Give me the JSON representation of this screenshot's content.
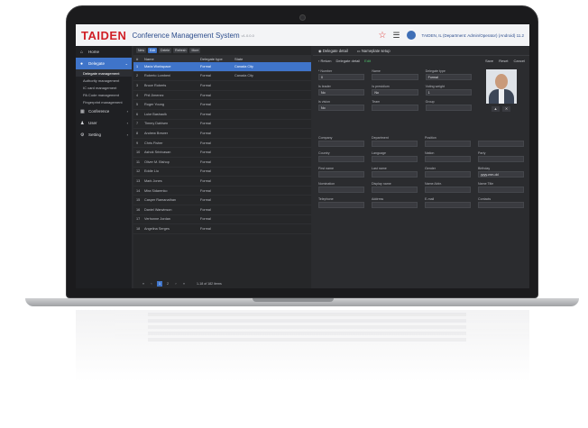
{
  "header": {
    "logo": "TAIDEN",
    "title": "Conference Management System",
    "version": "v1.0.0.0",
    "user": "TAIDEN, IL (Department: Admin/Operator) (Android) 11.2"
  },
  "sidebar": {
    "items": [
      {
        "label": "Home",
        "icon": "home-icon"
      },
      {
        "label": "Delegate",
        "icon": "person-icon",
        "active": true
      },
      {
        "label": "Conference",
        "icon": "grid-icon"
      },
      {
        "label": "User",
        "icon": "user-icon"
      },
      {
        "label": "Setting",
        "icon": "gear-icon"
      }
    ],
    "subitems": [
      "Delegate management",
      "Authority management",
      "IC card management",
      "PA Code management",
      "Fingerprint management"
    ]
  },
  "list": {
    "toolbar": [
      "New",
      "Edit",
      "Delete",
      "Refresh",
      "More"
    ],
    "columns": [
      "#",
      "Name",
      "Delegate type",
      "State"
    ],
    "rows": [
      {
        "n": "1",
        "name": "Maria Workspace",
        "type": "Formal",
        "state": "Canada City"
      },
      {
        "n": "2",
        "name": "Roberto Lombeni",
        "type": "Formal",
        "state": "Canada City"
      },
      {
        "n": "3",
        "name": "Bruce Roberts",
        "type": "Formal",
        "state": ""
      },
      {
        "n": "4",
        "name": "Phil Jimenez",
        "type": "Formal",
        "state": ""
      },
      {
        "n": "5",
        "name": "Roger Young",
        "type": "Formal",
        "state": ""
      },
      {
        "n": "6",
        "name": "Luke Bashaolk",
        "type": "Formal",
        "state": ""
      },
      {
        "n": "7",
        "name": "Timmy Dahlsen",
        "type": "Formal",
        "state": ""
      },
      {
        "n": "8",
        "name": "Andrew Brewer",
        "type": "Formal",
        "state": ""
      },
      {
        "n": "9",
        "name": "Chris Fisher",
        "type": "Formal",
        "state": ""
      },
      {
        "n": "10",
        "name": "Ashok Srinivasan",
        "type": "Formal",
        "state": ""
      },
      {
        "n": "11",
        "name": "Oliver M. Bishop",
        "type": "Formal",
        "state": ""
      },
      {
        "n": "12",
        "name": "Eddie Liu",
        "type": "Formal",
        "state": ""
      },
      {
        "n": "13",
        "name": "Mark Jones",
        "type": "Formal",
        "state": ""
      },
      {
        "n": "14",
        "name": "Mira Sidarenko",
        "type": "Formal",
        "state": ""
      },
      {
        "n": "15",
        "name": "Casper Ramanathan",
        "type": "Formal",
        "state": ""
      },
      {
        "n": "16",
        "name": "Daniel Warwinson",
        "type": "Formal",
        "state": ""
      },
      {
        "n": "17",
        "name": "Verhonne Jordan",
        "type": "Formal",
        "state": ""
      },
      {
        "n": "18",
        "name": "Angelina Serges",
        "type": "Formal",
        "state": ""
      }
    ],
    "pager": {
      "pages": [
        "1",
        "2"
      ],
      "current": "1",
      "summary": "1-18 of 182 items"
    }
  },
  "detail": {
    "tabs": [
      "Delegate detail",
      "Nameplate setup"
    ],
    "subbar": {
      "back": "Return",
      "crumb": "Delegate detail",
      "status": "Edit",
      "actions": [
        "Save",
        "Reset",
        "Cancel"
      ]
    },
    "fields_top": [
      [
        {
          "label": "* Number",
          "value": "0"
        },
        {
          "label": "Name",
          "value": ""
        },
        {
          "label": "Delegate type",
          "value": "Formal"
        }
      ],
      [
        {
          "label": "Is leader",
          "value": "No"
        },
        {
          "label": "Is presidium",
          "value": "No"
        },
        {
          "label": "Voting weight",
          "value": "1"
        }
      ],
      [
        {
          "label": "Is vision",
          "value": "No"
        },
        {
          "label": "Team",
          "value": ""
        },
        {
          "label": "Group",
          "value": ""
        }
      ]
    ],
    "fields_grid": [
      [
        {
          "label": "Company",
          "value": ""
        },
        {
          "label": "Department",
          "value": ""
        },
        {
          "label": "Position",
          "value": ""
        },
        {
          "label": "",
          "value": ""
        }
      ],
      [
        {
          "label": "Country",
          "value": ""
        },
        {
          "label": "Language",
          "value": ""
        },
        {
          "label": "Nation",
          "value": ""
        },
        {
          "label": "Party",
          "value": ""
        }
      ],
      [
        {
          "label": "First name",
          "value": ""
        },
        {
          "label": "Last name",
          "value": ""
        },
        {
          "label": "Gender",
          "value": ""
        },
        {
          "label": "Birthday",
          "value": "yyyy-mm-dd"
        }
      ],
      [
        {
          "label": "Nomination",
          "value": ""
        },
        {
          "label": "Display name",
          "value": ""
        },
        {
          "label": "Name Abbr.",
          "value": ""
        },
        {
          "label": "Name Title",
          "value": ""
        }
      ],
      [
        {
          "label": "Telephone",
          "value": ""
        },
        {
          "label": "Address",
          "value": ""
        },
        {
          "label": "E-mail",
          "value": ""
        },
        {
          "label": "Contacts",
          "value": ""
        }
      ]
    ]
  },
  "colors": {
    "accent": "#3f74c9",
    "brand": "#d01f26",
    "sidebar": "#1f2023",
    "panel": "#262729"
  }
}
